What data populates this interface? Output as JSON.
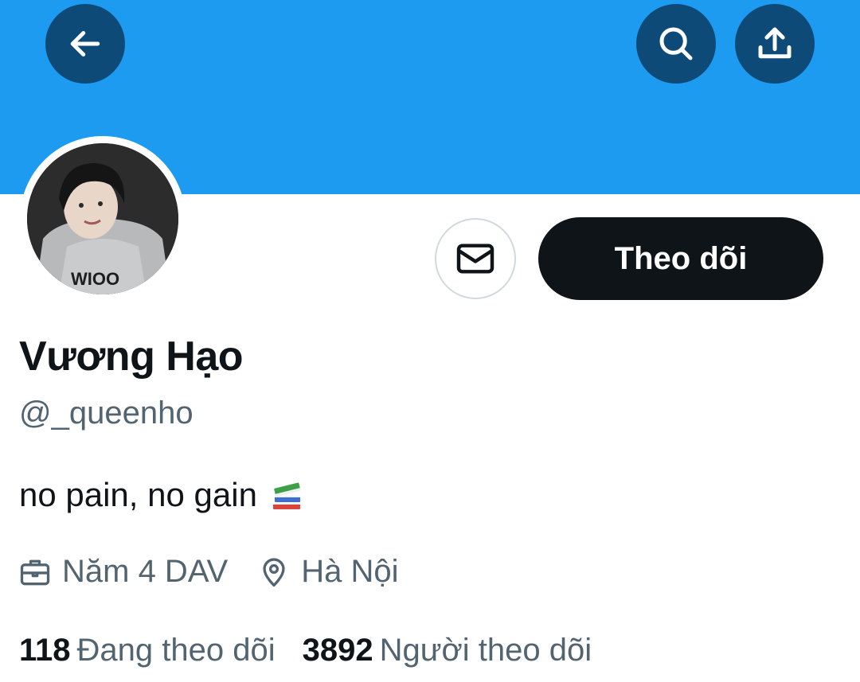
{
  "header": {
    "banner_color": "#1d9bf0",
    "back_icon": "arrow-left-icon",
    "search_icon": "search-icon",
    "share_icon": "share-upload-icon"
  },
  "profile": {
    "display_name": "Vương Hạo",
    "handle": "@_queenho",
    "bio": "no pain, no gain",
    "bio_emoji": "books-emoji",
    "occupation": "Năm 4 DAV",
    "location": "Hà Nội"
  },
  "actions": {
    "message_icon": "envelope-icon",
    "follow_label": "Theo dõi"
  },
  "stats": {
    "following_count": "118",
    "following_label": "Đang theo dõi",
    "followers_count": "3892",
    "followers_label": "Người theo dõi"
  }
}
